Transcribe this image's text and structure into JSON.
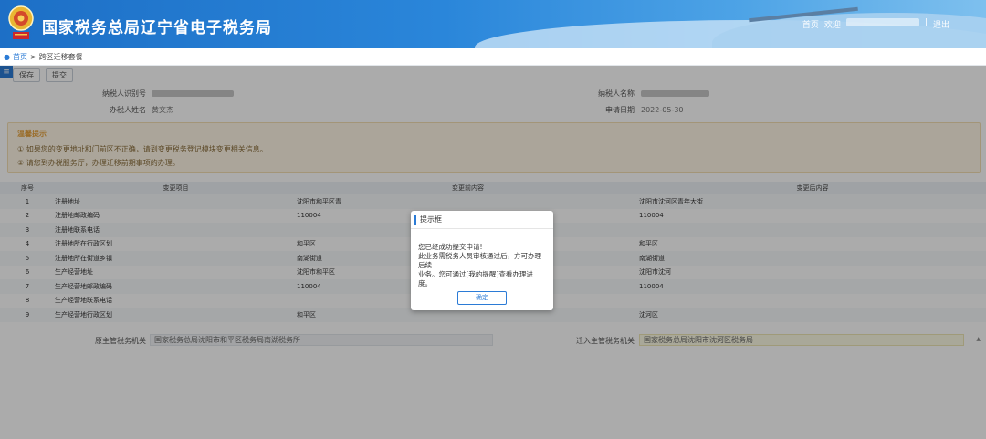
{
  "header": {
    "title": "国家税务总局辽宁省电子税务局",
    "nav_home": "首页",
    "nav_welcome": "欢迎",
    "nav_separator": "|",
    "nav_logout": "退出"
  },
  "breadcrumb": {
    "home": "首页",
    "separator": ">",
    "current": "跨区迁移套餐"
  },
  "toolbar": {
    "save_label": "保存",
    "submit_label": "提交"
  },
  "form": {
    "taxpayer_id_label": "纳税人识别号",
    "taxpayer_name_label": "纳税人名称",
    "handler_label": "办税人姓名",
    "handler_value": "黄文杰",
    "apply_date_label": "申请日期",
    "apply_date_value": "2022-05-30"
  },
  "notice": {
    "title": "温馨提示",
    "line1": "① 如果您的变更地址和门前区不正确，请到变更税务登记模块变更相关信息。",
    "line2": "② 请您到办税服务厅，办理迁移前期事项的办理。"
  },
  "table": {
    "headers": {
      "no": "序号",
      "item": "变更项目",
      "old": "变更前内容",
      "new": "变更后内容"
    },
    "rows": [
      {
        "no": "1",
        "item": "注册地址",
        "old": "沈阳市和平区青",
        "new": "沈阳市沈河区青年大街"
      },
      {
        "no": "2",
        "item": "注册地邮政编码",
        "old": "110004",
        "new": "110004"
      },
      {
        "no": "3",
        "item": "注册地联系电话",
        "old": "",
        "new": ""
      },
      {
        "no": "4",
        "item": "注册地所在行政区划",
        "old": "和平区",
        "new": "和平区"
      },
      {
        "no": "5",
        "item": "注册地所在街道乡镇",
        "old": "南湖街道",
        "new": "南湖街道"
      },
      {
        "no": "6",
        "item": "生产经营地址",
        "old": "沈阳市和平区",
        "new": "沈阳市沈河"
      },
      {
        "no": "7",
        "item": "生产经营地邮政编码",
        "old": "110004",
        "new": "110004"
      },
      {
        "no": "8",
        "item": "生产经营地联系电话",
        "old": "",
        "new": ""
      },
      {
        "no": "9",
        "item": "生产经营地行政区划",
        "old": "和平区",
        "new": "沈河区"
      }
    ]
  },
  "footer": {
    "out_label": "原主管税务机关",
    "out_value": "国家税务总局沈阳市和平区税务局南湖税务所",
    "in_label": "迁入主管税务机关",
    "in_value": "国家税务总局沈阳市沈河区税务局"
  },
  "modal": {
    "title": "提示框",
    "line1": "您已经成功提交申请!",
    "line2": "此业务需税务人员审核通过后，方可办理后续",
    "line3": "业务。您可通过[我的提醒]查看办理进度。",
    "ok_label": "确定"
  },
  "colors": {
    "brand": "#2b7bd6",
    "header_start": "#1d6fc6",
    "header_end": "#7ec0ee"
  }
}
